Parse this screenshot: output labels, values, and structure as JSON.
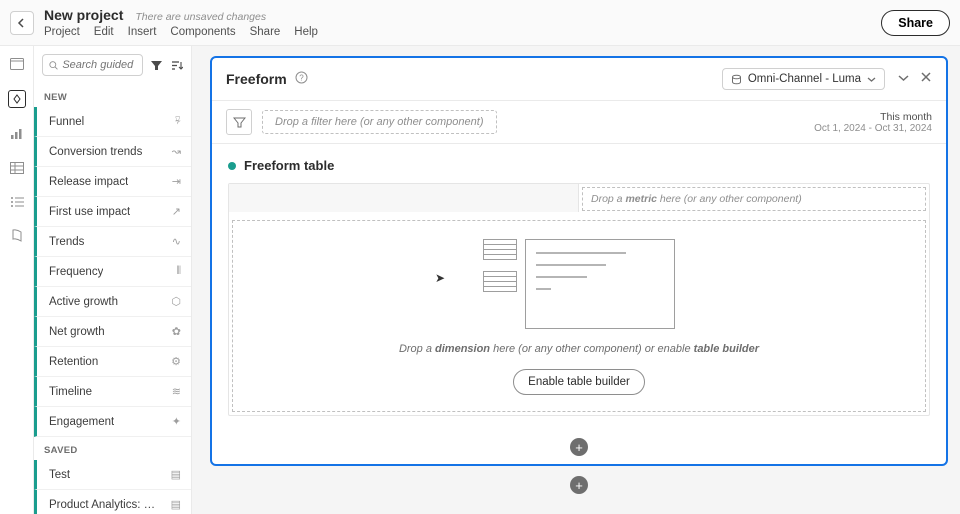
{
  "header": {
    "project_title": "New project",
    "unsaved_label": "There are unsaved changes",
    "menu": {
      "project": "Project",
      "edit": "Edit",
      "insert": "Insert",
      "components": "Components",
      "share": "Share",
      "help": "Help"
    },
    "share_button": "Share"
  },
  "sidebar": {
    "search_placeholder": "Search guided ana.",
    "section_new": "NEW",
    "section_saved": "SAVED",
    "new_items": [
      {
        "label": "Funnel"
      },
      {
        "label": "Conversion trends"
      },
      {
        "label": "Release impact"
      },
      {
        "label": "First use impact"
      },
      {
        "label": "Trends"
      },
      {
        "label": "Frequency"
      },
      {
        "label": "Active growth"
      },
      {
        "label": "Net growth"
      },
      {
        "label": "Retention"
      },
      {
        "label": "Timeline"
      },
      {
        "label": "Engagement"
      }
    ],
    "saved_items": [
      {
        "label": "Test"
      },
      {
        "label": "Product Analytics: Campai…"
      }
    ]
  },
  "panel": {
    "title": "Freeform",
    "dataview_label": "Omni-Channel - Luma",
    "drop_filter_text": "Drop a filter here (or any other component)",
    "date_label": "This month",
    "date_range": "Oct 1, 2024 - Oct 31, 2024",
    "table_title": "Freeform table",
    "metric_hint_pre": "Drop a ",
    "metric_hint_bold": "metric",
    "metric_hint_post": " here (or any other component)",
    "dim_hint_pre": "Drop a ",
    "dim_hint_bold": "dimension",
    "dim_hint_mid": " here (or any other component) or enable ",
    "dim_hint_bold2": "table builder",
    "enable_button": "Enable table builder"
  }
}
